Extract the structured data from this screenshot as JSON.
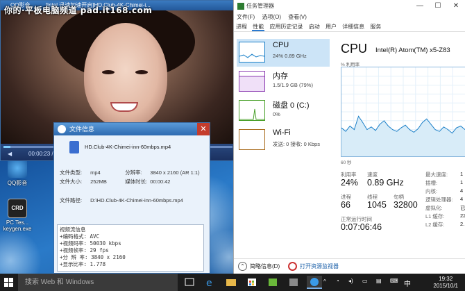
{
  "watermark": "你的·平板电脑频道 pad.it168.com",
  "desktop_icons": [
    {
      "label": "QQ影音"
    },
    {
      "label": "PC Tes..."
    },
    {
      "label": "keygen.exe"
    }
  ],
  "player": {
    "app": "QQ影音",
    "title": "[Intel 迅速加速开启]HD.Club-4K-Chimei-i...",
    "time": "00:00:23 /"
  },
  "file_info": {
    "title": "文件信息",
    "close": "✕",
    "file_name": "HD.Club-4K-Chimei-inn-60mbps.mp4",
    "rows": [
      {
        "label": "文件类型:",
        "value": "mp4",
        "label2": "分辨率:",
        "value2": "3840 x 2160 (AR 1:1)"
      },
      {
        "label": "文件大小:",
        "value": "252MB",
        "label2": "媒体时长:",
        "value2": "00:00:42"
      }
    ],
    "path_label": "文件路径:",
    "path_value": "D:\\HD.Club-4K-Chimei-inn-60mbps.mp4",
    "stream_header": "视频流信息",
    "stream_lines": [
      "+编码格式: AVC",
      "+视频码率: 50030 kbps",
      "+视频帧率: 29 fps",
      "+分 辨 率: 3840 x 2160",
      "+显示比率: 1.778"
    ]
  },
  "task_manager": {
    "title": "任务管理器",
    "window_buttons": [
      "—",
      "☐",
      "✕"
    ],
    "menu": [
      "文件(F)",
      "选项(O)",
      "查看(V)"
    ],
    "tabs": [
      "进程",
      "性能",
      "应用历史记录",
      "启动",
      "用户",
      "详细信息",
      "服务"
    ],
    "active_tab": "性能",
    "side_items": [
      {
        "name": "CPU",
        "sub": "24% 0.89 GHz",
        "color": "#1a7fc8"
      },
      {
        "name": "内存",
        "sub": "1.5/1.9 GB (79%)",
        "color": "#8a3ab0"
      },
      {
        "name": "磁盘 0 (C:)",
        "sub": "0%",
        "color": "#4aa02a"
      },
      {
        "name": "Wi-Fi",
        "sub": "发送: 0 接收: 0 Kbps",
        "color": "#a86a1a"
      }
    ],
    "main": {
      "title": "CPU",
      "model": "Intel(R) Atom(TM) x5-Z83",
      "util_label": "% 利用率",
      "graph_foot": "60 秒",
      "stats": [
        {
          "label": "利用率",
          "value": "24%"
        },
        {
          "label": "速度",
          "value": "0.89 GHz"
        },
        {
          "label": "进程",
          "value": "66"
        },
        {
          "label": "线程",
          "value": "1045"
        },
        {
          "label": "句柄",
          "value": "32800"
        },
        {
          "label": "正常运行时间",
          "value": "0:07:06:46"
        }
      ],
      "specs": [
        {
          "label": "最大速度:",
          "value": "1"
        },
        {
          "label": "插槽:",
          "value": "1"
        },
        {
          "label": "内核:",
          "value": "4"
        },
        {
          "label": "逻辑处理器:",
          "value": "4"
        },
        {
          "label": "虚拟化:",
          "value": "已"
        },
        {
          "label": "L1 缓存:",
          "value": "22"
        },
        {
          "label": "L2 缓存:",
          "value": "2."
        }
      ],
      "usage_history": [
        32,
        28,
        34,
        30,
        45,
        38,
        30,
        33,
        29,
        36,
        40,
        34,
        30,
        28,
        32,
        35,
        30,
        27,
        31,
        38,
        42,
        36,
        30,
        28,
        33,
        30,
        26,
        32,
        34,
        30
      ]
    },
    "footer": {
      "less": "简略信息(D)",
      "monitor": "打开资源监视器"
    }
  },
  "taskbar": {
    "search_placeholder": "搜索 Web 和 Windows",
    "ime": "中",
    "time": "19:32",
    "date": "2015/10/1"
  }
}
